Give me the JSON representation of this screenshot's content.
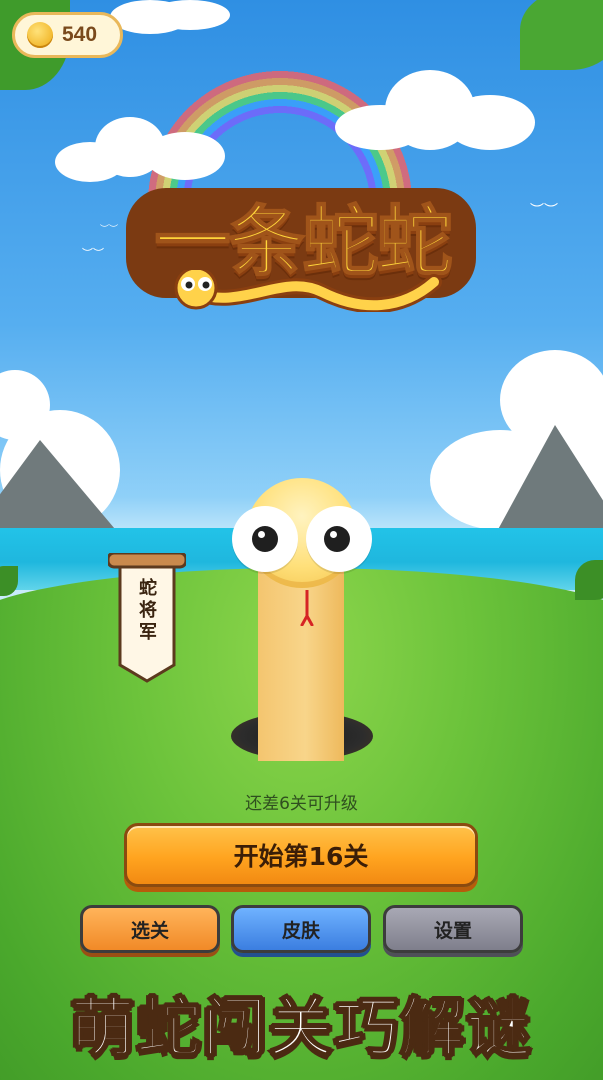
{
  "coins": {
    "value": "540"
  },
  "title": {
    "text": "一条蛇蛇"
  },
  "rank_banner": {
    "text": "蛇将军"
  },
  "upgrade_hint": "还差6关可升级",
  "buttons": {
    "start": "开始第16关",
    "levels": "选关",
    "skins": "皮肤",
    "settings": "设置"
  },
  "slogan": "萌蛇闯关巧解谜",
  "colors": {
    "start_button": "#ffa41f",
    "levels_button": "#f18a27",
    "skins_button": "#3b7ee0",
    "settings_button": "#7f7f8c",
    "logo_text": "#ffd53a"
  },
  "icons": [
    "coin-icon",
    "snake-mascot",
    "scroll-banner-icon",
    "rainbow",
    "cloud",
    "bird-icon"
  ]
}
